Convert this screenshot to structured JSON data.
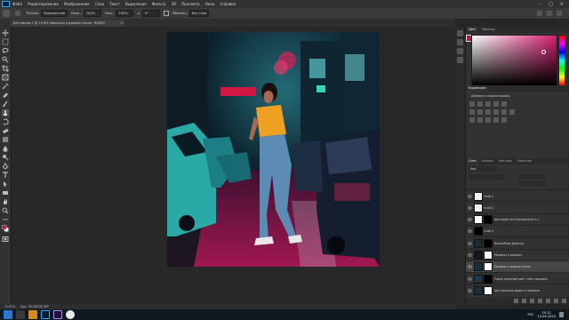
{
  "menubar": {
    "items": [
      "Файл",
      "Редактирование",
      "Изображение",
      "Слои",
      "Текст",
      "Выделение",
      "Фильтр",
      "3D",
      "Просмотр",
      "Окно",
      "Справка"
    ]
  },
  "options": {
    "mode_label": "Режим:",
    "mode_value": "Нормальный",
    "opacity_label": "Непр.:",
    "opacity_value": "100%",
    "flow_label": "Наж.:",
    "flow_value": "100%",
    "angle_value": "0°",
    "sample_label": "Образец:",
    "sample_value": "Все слои"
  },
  "document": {
    "tab_title": "Без имени-1 @ 15,6% (Машины и дорожн.поток, RGB/8)",
    "close_glyph": "×"
  },
  "status": {
    "zoom": "15,61%",
    "doc_size": "Док: 36,2M/362,6M"
  },
  "color_panel": {
    "tabs": [
      "Цвет",
      "Образцы"
    ],
    "fg_color": "#b3174f",
    "bg_color": "#f2f2f2"
  },
  "adjustments": {
    "title": "Коррекция",
    "subtitle": "Добавить корректировку"
  },
  "layers_panel": {
    "tabs": [
      "Слои",
      "Каналы",
      "Контуры",
      "Свойства"
    ],
    "kind_label": "Вид",
    "layers": [
      {
        "name": "Слой 1",
        "thumb": "#f2f2f2",
        "mask": "",
        "selected": false
      },
      {
        "name": "Слой 2",
        "thumb": "#f2f2f2",
        "mask": "",
        "selected": false
      },
      {
        "name": "Цветовой тон/Насыщенность 1",
        "thumb": "#ffffff",
        "mask": "#000000",
        "selected": false
      },
      {
        "name": "Слой 3",
        "thumb": "#000000",
        "mask": "",
        "selected": false
      },
      {
        "name": "Волшебная девочка",
        "thumb": "#1a2a33",
        "mask": "#000000",
        "selected": false
      },
      {
        "name": "Машины и дорожн.",
        "thumb": "#0d1a24",
        "mask": "#ffffff",
        "selected": false
      },
      {
        "name": "Машины и дорожн.поток",
        "thumb": "#183040",
        "mask": "#ffffff",
        "selected": true
      },
      {
        "name": "Улица (красный цвет, свет) машины",
        "thumb": "#203848",
        "mask": "#000000",
        "selected": false
      },
      {
        "name": "Центральная дорога и машины",
        "thumb": "#1b2d3b",
        "mask": "#ffffff",
        "selected": false
      }
    ]
  },
  "taskbar": {
    "time": "20:21",
    "date": "13.06.2020",
    "lang": "РУС"
  }
}
